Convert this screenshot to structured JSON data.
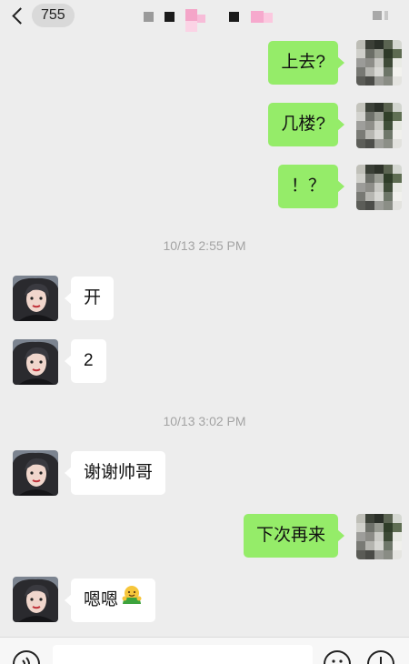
{
  "header": {
    "back_badge": "755"
  },
  "messages": [
    {
      "kind": "sent",
      "text": "上去?"
    },
    {
      "kind": "sent",
      "text": "几楼?"
    },
    {
      "kind": "sent",
      "text": "！？"
    },
    {
      "kind": "time",
      "text": "10/13 2:55 PM"
    },
    {
      "kind": "received",
      "text": "开"
    },
    {
      "kind": "received",
      "text": "2"
    },
    {
      "kind": "time",
      "text": "10/13 3:02 PM"
    },
    {
      "kind": "received",
      "text": "谢谢帅哥"
    },
    {
      "kind": "sent",
      "text": "下次再来"
    },
    {
      "kind": "received",
      "text": "嗯嗯"
    }
  ],
  "colors": {
    "background": "#ededed",
    "sent_bubble": "#95ec69",
    "received_bubble": "#ffffff",
    "timestamp": "#a3a3a3"
  },
  "icons": {
    "back": "chevron-left-icon",
    "more": "more-icon",
    "voice": "voice-icon",
    "emoji": "emoji-icon",
    "plus": "plus-icon",
    "bubble_emoji": "hugging-emoji"
  }
}
